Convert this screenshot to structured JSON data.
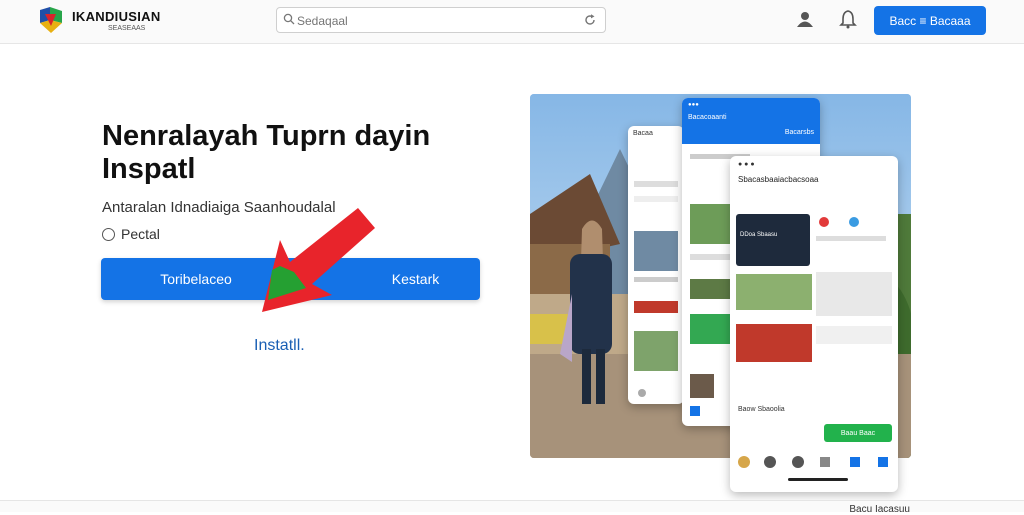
{
  "header": {
    "brand": "IKANDIUSIAN",
    "brand_sub": "SEASEAAS",
    "search_placeholder": "Sedaqaal",
    "login_label": "Bacc ≡ Bacaaa"
  },
  "hero": {
    "title": "Nenralayah Tuprn dayin Inspatl",
    "subtitle": "Antaralan Idnadiaiga Saanhoudalal",
    "radio_label": "Pectal",
    "cta_left": "Toribelaceo",
    "cta_right": "Kestark",
    "install_link": "Instatll."
  },
  "preview": {
    "phone1_title": "Bacaa",
    "phone2_title": "Bacacoaanti",
    "phone2_tab": "Bacarsbs",
    "phone3_title": "Sbacasbaaiacbacsoaa",
    "phone3_card": "DDoa Sbaasu",
    "phone3_row": "Baow Sbaoolia",
    "phone3_action": "Baau Baac"
  },
  "footer": {
    "text": "Bacu Iacasuu"
  },
  "colors": {
    "accent": "#1473e6",
    "arrow_red": "#e8242b",
    "arrow_green": "#25a032",
    "action_green": "#22b24c"
  }
}
